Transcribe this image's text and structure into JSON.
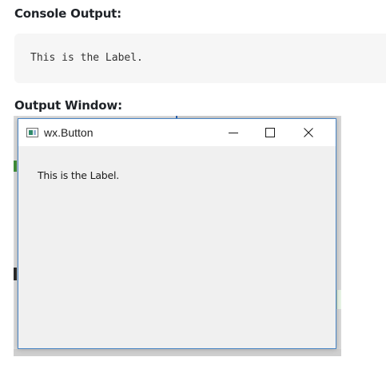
{
  "console_section": {
    "heading": "Console Output:",
    "output_text": "This is the Label."
  },
  "output_section": {
    "heading": "Output Window:"
  },
  "window": {
    "title": "wx.Button",
    "icon": "wx-app-icon",
    "controls": {
      "minimize_icon": "minimize-icon",
      "maximize_icon": "maximize-icon",
      "close_icon": "close-icon"
    },
    "label_text": "This is the Label."
  },
  "colors": {
    "window_border": "#4a86c6",
    "client_background": "#f0f0f0",
    "console_background": "#f6f6f6"
  }
}
